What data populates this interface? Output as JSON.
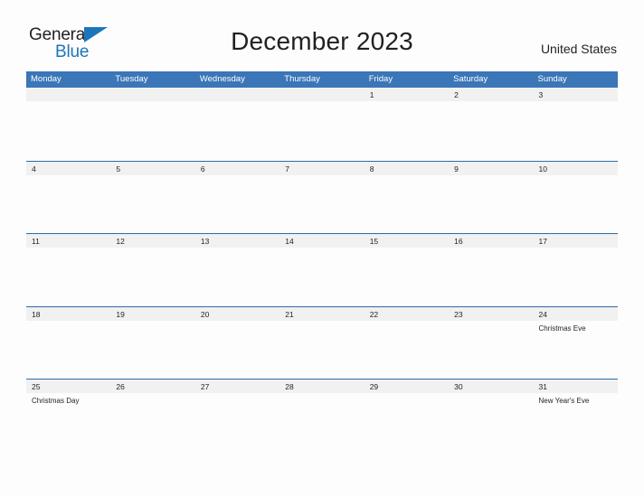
{
  "brand": {
    "name_part1": "General",
    "name_part2": "Blue",
    "flag_icon": "blue-flag-triangle-icon",
    "accent_color": "#1b75bb"
  },
  "header": {
    "title": "December 2023",
    "country": "United States"
  },
  "colors": {
    "header_bar_blue": "#3a76b8",
    "row_divider_blue": "#2e6da4",
    "day_band_gray": "#f1f1f1",
    "text_dark": "#231f20",
    "page_background": "#fdfdfd"
  },
  "calendar": {
    "weekday_headers": [
      "Monday",
      "Tuesday",
      "Wednesday",
      "Thursday",
      "Friday",
      "Saturday",
      "Sunday"
    ],
    "weeks": [
      {
        "days": [
          {
            "number": "",
            "event": ""
          },
          {
            "number": "",
            "event": ""
          },
          {
            "number": "",
            "event": ""
          },
          {
            "number": "",
            "event": ""
          },
          {
            "number": "1",
            "event": ""
          },
          {
            "number": "2",
            "event": ""
          },
          {
            "number": "3",
            "event": ""
          }
        ]
      },
      {
        "days": [
          {
            "number": "4",
            "event": ""
          },
          {
            "number": "5",
            "event": ""
          },
          {
            "number": "6",
            "event": ""
          },
          {
            "number": "7",
            "event": ""
          },
          {
            "number": "8",
            "event": ""
          },
          {
            "number": "9",
            "event": ""
          },
          {
            "number": "10",
            "event": ""
          }
        ]
      },
      {
        "days": [
          {
            "number": "11",
            "event": ""
          },
          {
            "number": "12",
            "event": ""
          },
          {
            "number": "13",
            "event": ""
          },
          {
            "number": "14",
            "event": ""
          },
          {
            "number": "15",
            "event": ""
          },
          {
            "number": "16",
            "event": ""
          },
          {
            "number": "17",
            "event": ""
          }
        ]
      },
      {
        "days": [
          {
            "number": "18",
            "event": ""
          },
          {
            "number": "19",
            "event": ""
          },
          {
            "number": "20",
            "event": ""
          },
          {
            "number": "21",
            "event": ""
          },
          {
            "number": "22",
            "event": ""
          },
          {
            "number": "23",
            "event": ""
          },
          {
            "number": "24",
            "event": "Christmas Eve"
          }
        ]
      },
      {
        "days": [
          {
            "number": "25",
            "event": "Christmas Day"
          },
          {
            "number": "26",
            "event": ""
          },
          {
            "number": "27",
            "event": ""
          },
          {
            "number": "28",
            "event": ""
          },
          {
            "number": "29",
            "event": ""
          },
          {
            "number": "30",
            "event": ""
          },
          {
            "number": "31",
            "event": "New Year's Eve"
          }
        ]
      }
    ]
  }
}
